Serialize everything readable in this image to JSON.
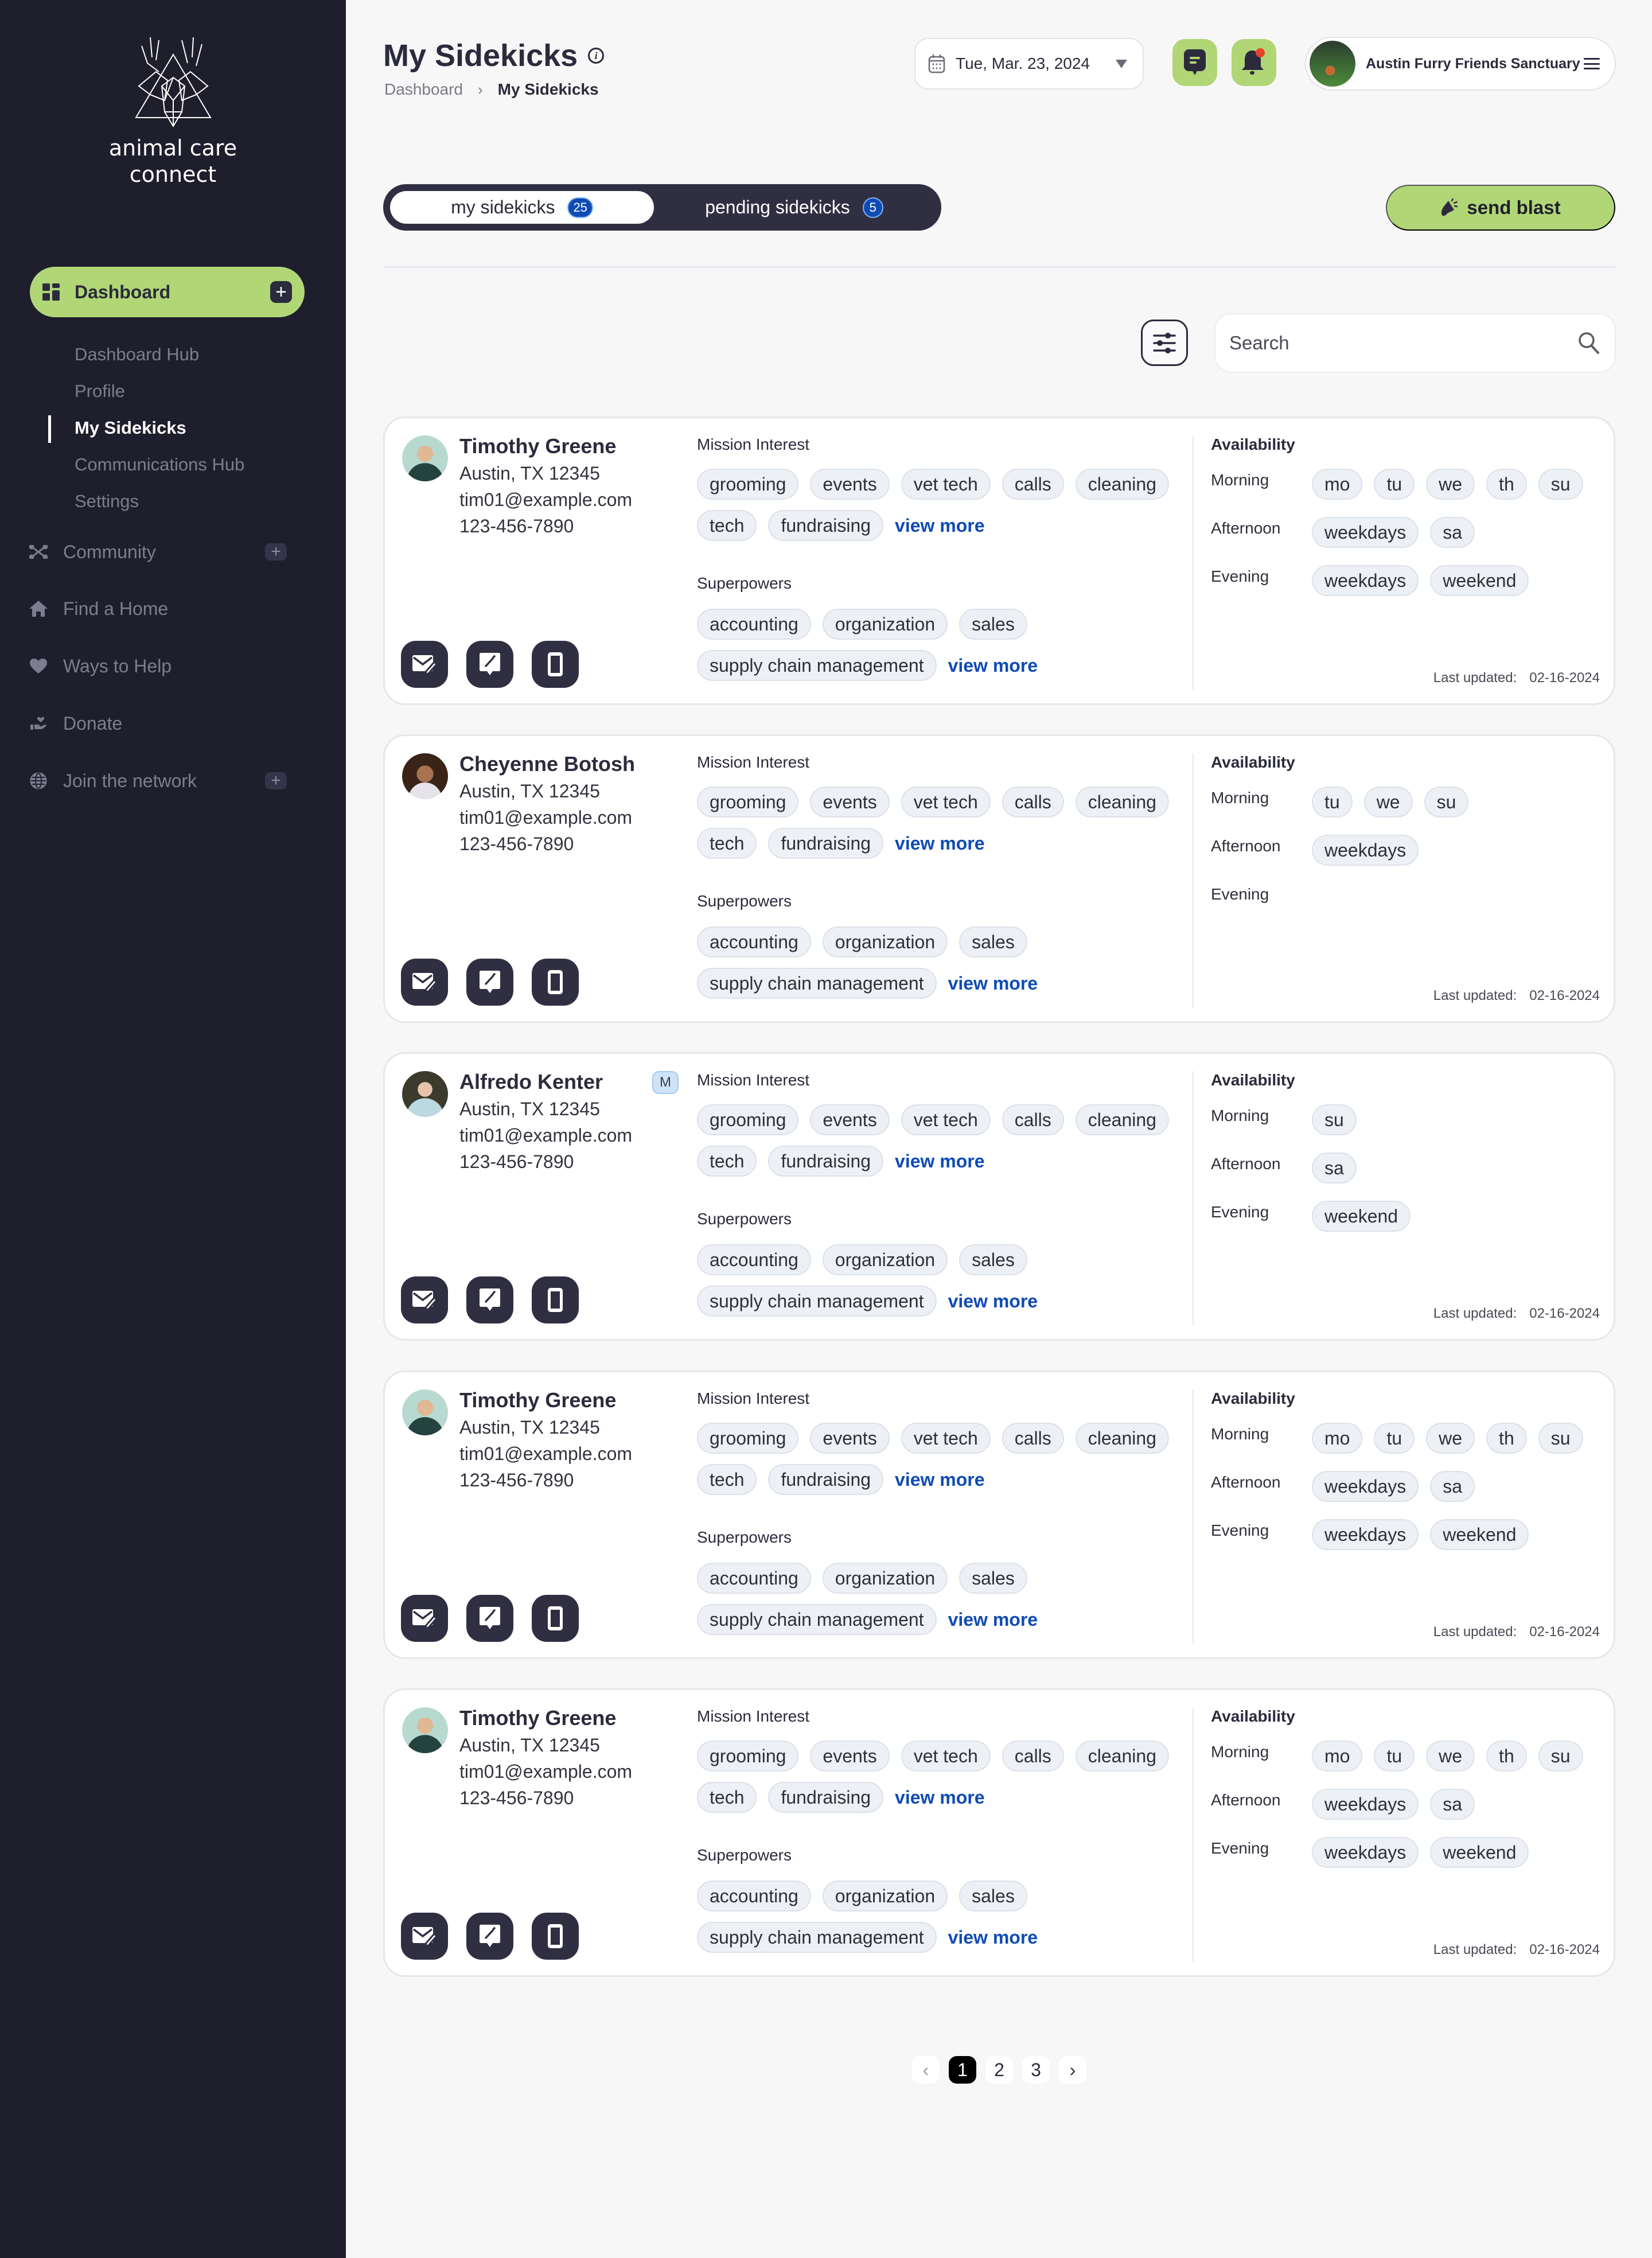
{
  "brand": {
    "name_line1": "animal care",
    "name_line2": "connect"
  },
  "colors": {
    "accent_green": "#b1d676",
    "sidebar_bg": "#1e1e2c",
    "link_blue": "#0f4bb5",
    "dark": "#302f42"
  },
  "sidebar": {
    "primary": {
      "label": "Dashboard",
      "icon": "dashboard-grid-icon"
    },
    "sub_items": [
      {
        "label": "Dashboard Hub",
        "active": false
      },
      {
        "label": "Profile",
        "active": false
      },
      {
        "label": "My Sidekicks",
        "active": true
      },
      {
        "label": "Communications Hub",
        "active": false
      },
      {
        "label": "Settings",
        "active": false
      }
    ],
    "items": [
      {
        "label": "Community",
        "icon": "network-icon",
        "expandable": true
      },
      {
        "label": "Find a Home",
        "icon": "home-icon",
        "expandable": false
      },
      {
        "label": "Ways to Help",
        "icon": "heart-icon",
        "expandable": false
      },
      {
        "label": "Donate",
        "icon": "donate-hand-icon",
        "expandable": false
      },
      {
        "label": "Join the network",
        "icon": "globe-icon",
        "expandable": true
      }
    ]
  },
  "header": {
    "title": "My Sidekicks",
    "breadcrumb": {
      "parent": "Dashboard",
      "separator": "›",
      "current": "My Sidekicks"
    },
    "date": "Tue, Mar. 23, 2024",
    "org_name": "Austin Furry Friends Sanctuary",
    "notification_dot_color": "#e8442a"
  },
  "tabs": [
    {
      "label": "my sidekicks",
      "count": "25",
      "active": true
    },
    {
      "label": "pending sidekicks",
      "count": "5",
      "active": false
    }
  ],
  "actions": {
    "send_blast": "send blast"
  },
  "search": {
    "placeholder": "Search",
    "value": ""
  },
  "labels": {
    "mission_interest": "Mission Interest",
    "superpowers": "Superpowers",
    "availability": "Availability",
    "morning": "Morning",
    "afternoon": "Afternoon",
    "evening": "Evening",
    "view_more": "view more",
    "last_updated": "Last updated:"
  },
  "sidekicks": [
    {
      "name": "Timothy Greene",
      "location": "Austin, TX 12345",
      "email": "tim01@example.com",
      "phone": "123-456-7890",
      "badge": "",
      "mission_interest": [
        "grooming",
        "events",
        "vet tech",
        "calls",
        "cleaning",
        "tech",
        "fundraising"
      ],
      "superpowers": [
        "accounting",
        "organization",
        "sales",
        "supply chain management"
      ],
      "availability": {
        "morning": [
          "mo",
          "tu",
          "we",
          "th",
          "su"
        ],
        "afternoon": [
          "weekdays",
          "sa"
        ],
        "evening": [
          "weekdays",
          "weekend"
        ]
      },
      "last_updated": "02-16-2024"
    },
    {
      "name": "Cheyenne Botosh",
      "location": "Austin, TX 12345",
      "email": "tim01@example.com",
      "phone": "123-456-7890",
      "badge": "",
      "mission_interest": [
        "grooming",
        "events",
        "vet tech",
        "calls",
        "cleaning",
        "tech",
        "fundraising"
      ],
      "superpowers": [
        "accounting",
        "organization",
        "sales",
        "supply chain management"
      ],
      "availability": {
        "morning": [
          "tu",
          "we",
          "su"
        ],
        "afternoon": [
          "weekdays"
        ],
        "evening": []
      },
      "last_updated": "02-16-2024"
    },
    {
      "name": "Alfredo Kenter",
      "location": "Austin, TX 12345",
      "email": "tim01@example.com",
      "phone": "123-456-7890",
      "badge": "M",
      "mission_interest": [
        "grooming",
        "events",
        "vet tech",
        "calls",
        "cleaning",
        "tech",
        "fundraising"
      ],
      "superpowers": [
        "accounting",
        "organization",
        "sales",
        "supply chain management"
      ],
      "availability": {
        "morning": [
          "su"
        ],
        "afternoon": [
          "sa"
        ],
        "evening": [
          "weekend"
        ]
      },
      "last_updated": "02-16-2024"
    },
    {
      "name": "Timothy Greene",
      "location": "Austin, TX 12345",
      "email": "tim01@example.com",
      "phone": "123-456-7890",
      "badge": "",
      "mission_interest": [
        "grooming",
        "events",
        "vet tech",
        "calls",
        "cleaning",
        "tech",
        "fundraising"
      ],
      "superpowers": [
        "accounting",
        "organization",
        "sales",
        "supply chain management"
      ],
      "availability": {
        "morning": [
          "mo",
          "tu",
          "we",
          "th",
          "su"
        ],
        "afternoon": [
          "weekdays",
          "sa"
        ],
        "evening": [
          "weekdays",
          "weekend"
        ]
      },
      "last_updated": "02-16-2024"
    },
    {
      "name": "Timothy Greene",
      "location": "Austin, TX 12345",
      "email": "tim01@example.com",
      "phone": "123-456-7890",
      "badge": "",
      "mission_interest": [
        "grooming",
        "events",
        "vet tech",
        "calls",
        "cleaning",
        "tech",
        "fundraising"
      ],
      "superpowers": [
        "accounting",
        "organization",
        "sales",
        "supply chain management"
      ],
      "availability": {
        "morning": [
          "mo",
          "tu",
          "we",
          "th",
          "su"
        ],
        "afternoon": [
          "weekdays",
          "sa"
        ],
        "evening": [
          "weekdays",
          "weekend"
        ]
      },
      "last_updated": "02-16-2024"
    }
  ],
  "pagination": {
    "pages": [
      "1",
      "2",
      "3"
    ],
    "current": "1",
    "prev": "‹",
    "next": "›"
  }
}
